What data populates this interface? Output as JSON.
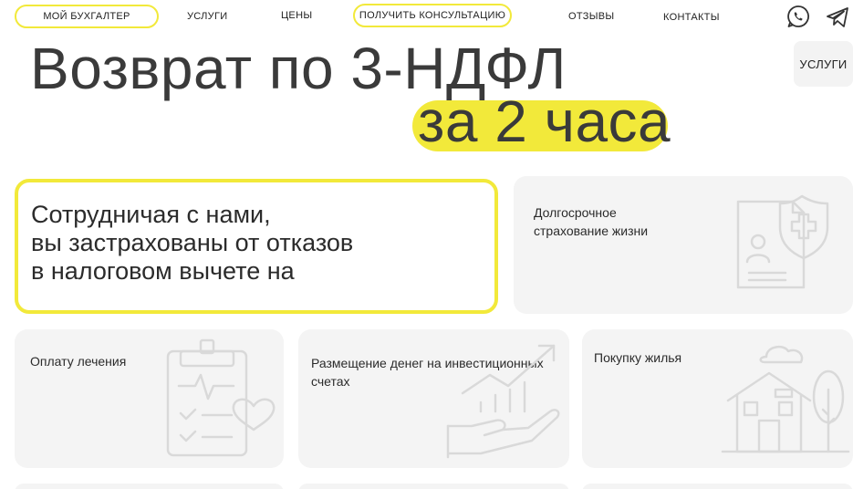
{
  "nav": {
    "brand": "МОЙ БУХГАЛТЕР",
    "services": "УСЛУГИ",
    "prices": "ЦЕНЫ",
    "consult": "ПОЛУЧИТЬ КОНСУЛЬТАЦИЮ",
    "reviews": "ОТЗЫВЫ",
    "contacts": "КОНТАКТЫ",
    "icons": [
      "whatsapp-icon",
      "telegram-icon"
    ]
  },
  "hero": {
    "title": "Возврат по 3-НДФЛ",
    "subtitle": "за 2 часа",
    "services_button": "УСЛУГИ"
  },
  "feature": {
    "text": "Сотрудничая с нами,\nвы застрахованы от отказов\nв налоговом вычете на"
  },
  "cards": [
    {
      "label": "Долгосрочное\nстрахование жизни",
      "icon": "insurance-document-icon"
    },
    {
      "label": "Оплату лечения",
      "icon": "medical-clipboard-icon"
    },
    {
      "label": "Размещение денег на инвестиционных\nсчетах",
      "icon": "investment-hand-icon"
    },
    {
      "label": "Покупку жилья",
      "icon": "house-icon"
    }
  ],
  "colors": {
    "accent": "#f2e93a",
    "card_bg": "#f4f4f4",
    "text": "#2b2b2b"
  }
}
